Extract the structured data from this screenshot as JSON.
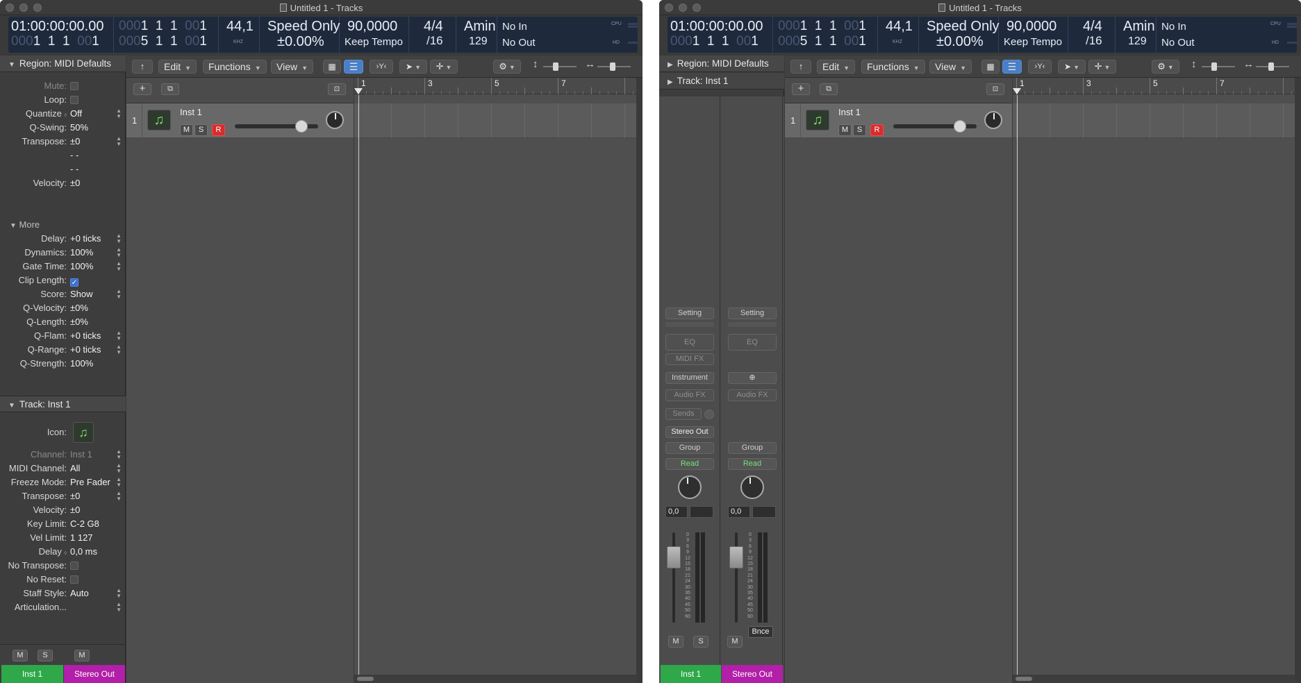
{
  "window_title": "Untitled 1 - Tracks",
  "lcd": {
    "position_time": "01:00:00:00.00",
    "bars_dim": "000",
    "bars_1": "1",
    "bars_beat": "1",
    "bars_div": "1",
    "bars_tick_dim": "00",
    "bars_tick": "1",
    "end_dim": "000",
    "end_bar": "5",
    "sample_rate": "44,1",
    "sample_rate_unit": "KHZ",
    "mode": "Speed Only",
    "mode_value": "±0.00%",
    "tempo": "90,0000",
    "tempo_mode": "Keep Tempo",
    "signature": "4/4",
    "division": "/16",
    "key": "Amin",
    "key_num": "129",
    "midi_in": "No In",
    "midi_out": "No Out",
    "cpu_label": "CPU",
    "hd_label": "HD"
  },
  "toolbar": {
    "back_icon": "↑",
    "edit": "Edit",
    "functions": "Functions",
    "view": "View"
  },
  "inspector": {
    "region_header": "Region:",
    "region_name": "MIDI Defaults",
    "rows_top": [
      {
        "label": "Mute:",
        "value": "",
        "type": "check",
        "dim": true
      },
      {
        "label": "Loop:",
        "value": "",
        "type": "check",
        "dim": false
      },
      {
        "label": "Quantize",
        "value": "Off",
        "type": "select"
      },
      {
        "label": "Q-Swing:",
        "value": "50%",
        "type": "text"
      },
      {
        "label": "Transpose:",
        "value": "±0",
        "type": "select"
      },
      {
        "label": "",
        "value": "- -",
        "type": "text"
      },
      {
        "label": "",
        "value": "- -",
        "type": "text"
      },
      {
        "label": "Velocity:",
        "value": "±0",
        "type": "text"
      }
    ],
    "more": "More",
    "rows_more": [
      {
        "label": "Delay:",
        "value": "+0 ticks",
        "type": "select"
      },
      {
        "label": "Dynamics:",
        "value": "100%",
        "type": "select"
      },
      {
        "label": "Gate Time:",
        "value": "100%",
        "type": "select"
      },
      {
        "label": "Clip Length:",
        "value": "",
        "type": "checkon"
      },
      {
        "label": "Score:",
        "value": "Show",
        "type": "select"
      },
      {
        "label": "Q-Velocity:",
        "value": "±0%",
        "type": "text"
      },
      {
        "label": "Q-Length:",
        "value": "±0%",
        "type": "text"
      },
      {
        "label": "Q-Flam:",
        "value": "+0 ticks",
        "type": "select"
      },
      {
        "label": "Q-Range:",
        "value": "+0 ticks",
        "type": "select"
      },
      {
        "label": "Q-Strength:",
        "value": "100%",
        "type": "text"
      }
    ],
    "track_header": "Track:",
    "track_name": "Inst 1",
    "icon_label": "Icon:",
    "rows_track": [
      {
        "label": "Channel:",
        "value": "Inst 1",
        "type": "select",
        "dim": true
      },
      {
        "label": "MIDI Channel:",
        "value": "All",
        "type": "select"
      },
      {
        "label": "Freeze Mode:",
        "value": "Pre Fader",
        "type": "select"
      },
      {
        "label": "Transpose:",
        "value": "±0",
        "type": "select"
      },
      {
        "label": "Velocity:",
        "value": "±0",
        "type": "text"
      },
      {
        "label": "Key Limit:",
        "value": "C-2  G8",
        "type": "text"
      },
      {
        "label": "Vel Limit:",
        "value": "1  127",
        "type": "text"
      },
      {
        "label": "Delay",
        "value": "0,0 ms",
        "type": "text"
      },
      {
        "label": "No Transpose:",
        "value": "",
        "type": "check"
      },
      {
        "label": "No Reset:",
        "value": "",
        "type": "check"
      },
      {
        "label": "Staff Style:",
        "value": "Auto",
        "type": "select"
      },
      {
        "label": "Articulation...",
        "value": "",
        "type": "select"
      }
    ],
    "m": "M",
    "s": "S",
    "strip1": "Inst 1",
    "strip2": "Stereo Out"
  },
  "track": {
    "number": "1",
    "name": "Inst 1",
    "m": "M",
    "s": "S",
    "r": "R",
    "volume": 0.8
  },
  "ruler": [
    "1",
    "3",
    "5",
    "7"
  ],
  "mixer": {
    "setting": "Setting",
    "eq": "EQ",
    "midi_fx": "MIDI FX",
    "instrument": "Instrument",
    "audio_fx": "Audio FX",
    "sends": "Sends",
    "stereo_out": "Stereo Out",
    "group": "Group",
    "read": "Read",
    "value": "0,0",
    "scale": [
      "0",
      "3",
      "6",
      "9",
      "12",
      "15",
      "18",
      "21",
      "24",
      "30",
      "35",
      "40",
      "45",
      "50",
      "60"
    ],
    "bnce": "Bnce",
    "m": "M",
    "s": "S",
    "strip1": "Inst 1",
    "strip2": "Stereo Out"
  },
  "colors": {
    "green_strip": "#2fa84a",
    "magenta_strip": "#b21fa8",
    "record": "#d62d2d"
  }
}
